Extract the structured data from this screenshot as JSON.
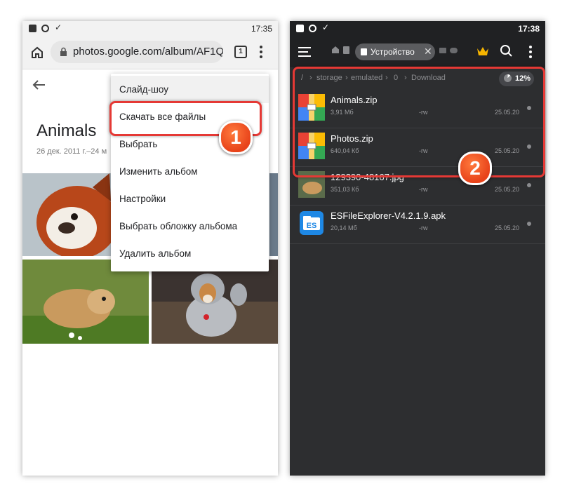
{
  "left_screen": {
    "status_time": "17:35",
    "url": "photos.google.com/album/AF1QipN",
    "tab_count": "1",
    "album_title": "Animals",
    "album_date": "26 дек. 2011 г.–24 м",
    "menu_items": [
      "Слайд-шоу",
      "Скачать все файлы",
      "Выбрать",
      "Изменить альбом",
      "Настройки",
      "Выбрать обложку альбома",
      "Удалить альбом"
    ],
    "step_badge": "1"
  },
  "right_screen": {
    "status_time": "17:38",
    "tab_label": "Устройство",
    "breadcrumb": [
      "/",
      "storage",
      "emulated",
      "0",
      "Download"
    ],
    "storage_percent": "12%",
    "files": [
      {
        "name": "Animals.zip",
        "size": "3,91 Мб",
        "perm": "-rw",
        "date": "25.05.20",
        "icon": "zip-archive-icon"
      },
      {
        "name": "Photos.zip",
        "size": "640,04 Кб",
        "perm": "-rw",
        "date": "25.05.20",
        "icon": "zip-archive-icon"
      },
      {
        "name": "129390-48167.jpg",
        "size": "351,03 Кб",
        "perm": "-rw",
        "date": "25.05.20",
        "icon": "image-thumbnail"
      },
      {
        "name": "ESFileExplorer-V4.2.1.9.apk",
        "size": "20,14 Мб",
        "perm": "-rw",
        "date": "25.05.20",
        "icon": "es-app-icon"
      }
    ],
    "step_badge": "2"
  },
  "colors": {
    "highlight": "#e53935",
    "badge": "#e8431a",
    "dark_bg": "#2d2e30"
  }
}
